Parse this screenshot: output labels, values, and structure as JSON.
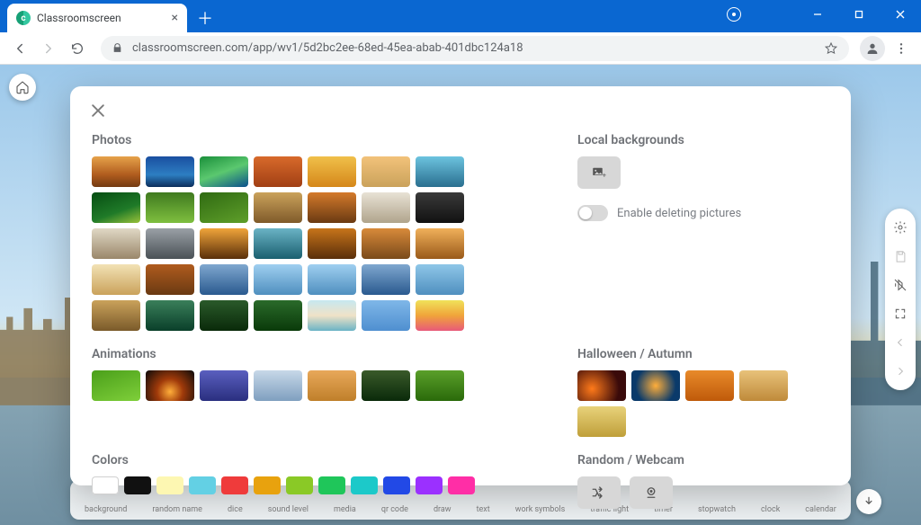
{
  "browser": {
    "tab_title": "Classroomscreen",
    "url": "classroomscreen.com/app/wv1/5d2bc2ee-68ed-45ea-abab-401dbc124a18"
  },
  "modal": {
    "photos_heading": "Photos",
    "animations_heading": "Animations",
    "halloween_heading": "Halloween / Autumn",
    "colors_heading": "Colors",
    "random_heading": "Random / Webcam",
    "local_heading": "Local backgrounds",
    "delete_toggle_label": "Enable deleting pictures",
    "colors": [
      "#ffffff",
      "#111111",
      "#fdf7b2",
      "#63d0e4",
      "#ef3b3b",
      "#e8a20e",
      "#8ac926",
      "#1fc65a",
      "#1cc9c9",
      "#2249e6",
      "#9b30ff",
      "#ff2ea6"
    ]
  },
  "dock": {
    "items": [
      "background",
      "random name",
      "dice",
      "sound level",
      "media",
      "qr code",
      "draw",
      "text",
      "work symbols",
      "traffic light",
      "timer",
      "stopwatch",
      "clock",
      "calendar"
    ]
  }
}
